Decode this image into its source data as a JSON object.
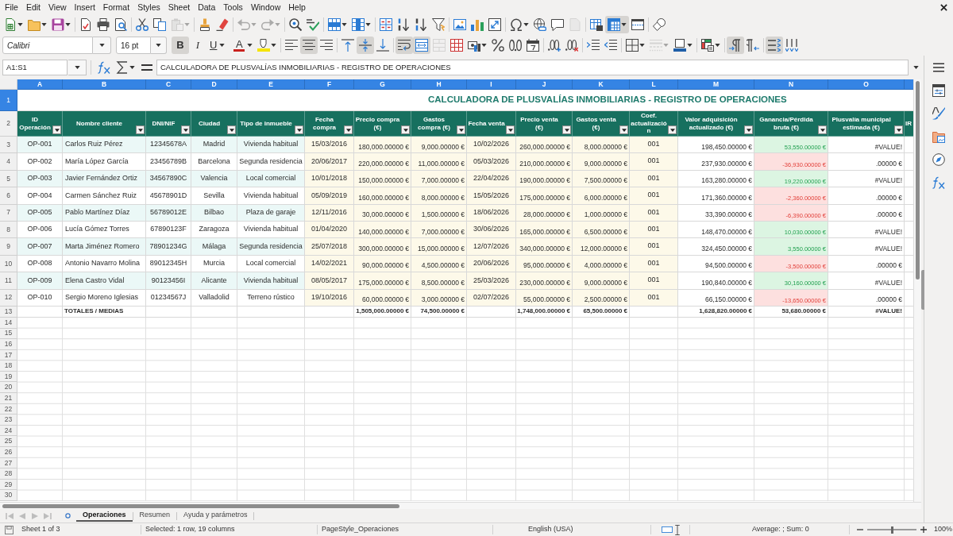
{
  "menu_bar": [
    "File",
    "Edit",
    "View",
    "Insert",
    "Format",
    "Styles",
    "Sheet",
    "Data",
    "Tools",
    "Window",
    "Help"
  ],
  "standard_toolbar": {
    "paste_enabled": false,
    "undo_enabled": false,
    "redo_enabled": false,
    "headers_footers_enabled": false,
    "freeze_rows_columns": true
  },
  "formatting_toolbar": {
    "font_name": "Calibri",
    "font_size": "16 pt",
    "bold_button": {
      "label": "B",
      "pressed": true
    },
    "italic_button": {
      "label": "I",
      "pressed": false
    },
    "underline_button": {
      "label": "U",
      "pressed": false
    },
    "font_color_label": "A",
    "align_left": false,
    "align_center": true,
    "align_right": false,
    "align_top": false,
    "align_middle": true,
    "align_bottom": false,
    "wrap_text": true,
    "merge_and_center": true,
    "merge_cells_enabled": false,
    "border_style_enabled": false,
    "left_to_right": true,
    "right_to_left": false,
    "text_horizontal": true,
    "text_vertical": false
  },
  "formula_bar": {
    "name_box": "A1:S1",
    "content": "CALCULADORA DE PLUSVALÍAS INMOBILIARIAS - REGISTRO DE OPERACIONES"
  },
  "sheet": {
    "columns": [
      {
        "letter": "A",
        "selected": true,
        "heading": "ID Operación"
      },
      {
        "letter": "B",
        "selected": true,
        "heading": "Nombre cliente"
      },
      {
        "letter": "C",
        "selected": true,
        "heading": "DNI/NIF"
      },
      {
        "letter": "D",
        "selected": true,
        "heading": "Ciudad"
      },
      {
        "letter": "E",
        "selected": true,
        "heading": "Tipo de inmueble"
      },
      {
        "letter": "F",
        "selected": true,
        "heading": "Fecha compra"
      },
      {
        "letter": "G",
        "selected": true,
        "heading": "Precio compra (€)"
      },
      {
        "letter": "H",
        "selected": true,
        "heading": "Gastos compra (€)"
      },
      {
        "letter": "I",
        "selected": true,
        "heading": "Fecha venta"
      },
      {
        "letter": "J",
        "selected": true,
        "heading": "Precio venta (€)"
      },
      {
        "letter": "K",
        "selected": true,
        "heading": "Gastos venta (€)"
      },
      {
        "letter": "L",
        "selected": true,
        "heading": "Coef. actualización"
      },
      {
        "letter": "M",
        "selected": true,
        "heading": "Valor adquisición actualizado (€)"
      },
      {
        "letter": "N",
        "selected": true,
        "heading": "Ganancia/Pérdida bruta (€)"
      },
      {
        "letter": "O",
        "selected": true,
        "heading": "Plusvalía municipal estimada (€)"
      }
    ],
    "partial_column": {
      "selected": true,
      "heading": "IR"
    },
    "autofilter": true,
    "title_row": {
      "number": "1",
      "selected": true,
      "text": "CALCULADORA DE PLUSVALÍAS INMOBILIARIAS - REGISTRO DE OPERACIONES"
    },
    "heading_row": {
      "number": "2",
      "selected": false
    },
    "rows": [
      {
        "number": "3",
        "selected": false,
        "loss": false,
        "cells": [
          "OP-001",
          "Carlos Ruiz Pérez",
          "12345678A",
          "Madrid",
          "Vivienda habitual",
          "15/03/2016",
          "180,000.00000 €",
          "9,000.00000 €",
          "10/02/2026",
          "260,000.00000 €",
          "8,000.00000 €",
          "001",
          "198,450.00000 €",
          "53,550.00000 €",
          "#VALUE!"
        ]
      },
      {
        "number": "4",
        "selected": false,
        "loss": true,
        "cells": [
          "OP-002",
          "María López García",
          "23456789B",
          "Barcelona",
          "Segunda residencia",
          "20/06/2017",
          "220,000.00000 €",
          "11,000.00000 €",
          "05/03/2026",
          "210,000.00000 €",
          "9,000.00000 €",
          "001",
          "237,930.00000 €",
          "-36,930.00000 €",
          ".00000 €"
        ]
      },
      {
        "number": "5",
        "selected": false,
        "loss": false,
        "cells": [
          "OP-003",
          "Javier Fernández Ortiz",
          "34567890C",
          "Valencia",
          "Local comercial",
          "10/01/2018",
          "150,000.00000 €",
          "7,000.00000 €",
          "22/04/2026",
          "190,000.00000 €",
          "7,500.00000 €",
          "001",
          "163,280.00000 €",
          "19,220.00000 €",
          "#VALUE!"
        ]
      },
      {
        "number": "6",
        "selected": false,
        "loss": true,
        "cells": [
          "OP-004",
          "Carmen Sánchez Ruiz",
          "45678901D",
          "Sevilla",
          "Vivienda habitual",
          "05/09/2019",
          "160,000.00000 €",
          "8,000.00000 €",
          "15/05/2026",
          "175,000.00000 €",
          "6,000.00000 €",
          "001",
          "171,360.00000 €",
          "-2,360.00000 €",
          ".00000 €"
        ]
      },
      {
        "number": "7",
        "selected": false,
        "loss": true,
        "cells": [
          "OP-005",
          "Pablo Martínez Díaz",
          "56789012E",
          "Bilbao",
          "Plaza de garaje",
          "12/11/2016",
          "30,000.00000 €",
          "1,500.00000 €",
          "18/06/2026",
          "28,000.00000 €",
          "1,000.00000 €",
          "001",
          "33,390.00000 €",
          "-6,390.00000 €",
          ".00000 €"
        ]
      },
      {
        "number": "8",
        "selected": false,
        "loss": false,
        "cells": [
          "OP-006",
          "Lucía Gómez Torres",
          "67890123F",
          "Zaragoza",
          "Vivienda habitual",
          "01/04/2020",
          "140,000.00000 €",
          "7,000.00000 €",
          "30/06/2026",
          "165,000.00000 €",
          "6,500.00000 €",
          "001",
          "148,470.00000 €",
          "10,030.00000 €",
          "#VALUE!"
        ]
      },
      {
        "number": "9",
        "selected": false,
        "loss": false,
        "cells": [
          "OP-007",
          "Marta Jiménez Romero",
          "78901234G",
          "Málaga",
          "Segunda residencia",
          "25/07/2018",
          "300,000.00000 €",
          "15,000.00000 €",
          "12/07/2026",
          "340,000.00000 €",
          "12,000.00000 €",
          "001",
          "324,450.00000 €",
          "3,550.00000 €",
          "#VALUE!"
        ]
      },
      {
        "number": "10",
        "selected": false,
        "loss": true,
        "cells": [
          "OP-008",
          "Antonio Navarro Molina",
          "89012345H",
          "Murcia",
          "Local comercial",
          "14/02/2021",
          "90,000.00000 €",
          "4,500.00000 €",
          "20/06/2026",
          "95,000.00000 €",
          "4,000.00000 €",
          "001",
          "94,500.00000 €",
          "-3,500.00000 €",
          ".00000 €"
        ]
      },
      {
        "number": "11",
        "selected": false,
        "loss": false,
        "cells": [
          "OP-009",
          "Elena Castro Vidal",
          "90123456I",
          "Alicante",
          "Vivienda habitual",
          "08/05/2017",
          "175,000.00000 €",
          "8,500.00000 €",
          "25/03/2026",
          "230,000.00000 €",
          "9,000.00000 €",
          "001",
          "190,840.00000 €",
          "30,160.00000 €",
          "#VALUE!"
        ]
      },
      {
        "number": "12",
        "selected": false,
        "loss": true,
        "cells": [
          "OP-010",
          "Sergio Moreno Iglesias",
          "01234567J",
          "Valladolid",
          "Terreno rústico",
          "19/10/2016",
          "60,000.00000 €",
          "3,000.00000 €",
          "02/07/2026",
          "55,000.00000 €",
          "2,500.00000 €",
          "001",
          "66,150.00000 €",
          "-13,650.00000 €",
          ".00000 €"
        ]
      }
    ],
    "totals_row": {
      "number": "13",
      "selected": false,
      "cells": {
        "B": "TOTALES / MEDIAS",
        "G": "1,505,000.00000 €",
        "H": "74,500.00000 €",
        "J": "1,748,000.00000 €",
        "K": "65,500.00000 €",
        "M": "1,628,820.00000 €",
        "N": "53,680.00000 €",
        "O": "#VALUE!"
      }
    },
    "empty_rows": [
      {
        "number": "14",
        "selected": false
      },
      {
        "number": "15",
        "selected": false
      },
      {
        "number": "16",
        "selected": false
      },
      {
        "number": "17",
        "selected": false
      },
      {
        "number": "18",
        "selected": false
      },
      {
        "number": "19",
        "selected": false
      },
      {
        "number": "20",
        "selected": false
      },
      {
        "number": "21",
        "selected": false
      },
      {
        "number": "22",
        "selected": false
      },
      {
        "number": "23",
        "selected": false
      },
      {
        "number": "24",
        "selected": false
      },
      {
        "number": "25",
        "selected": false
      },
      {
        "number": "26",
        "selected": false
      },
      {
        "number": "27",
        "selected": false
      },
      {
        "number": "28",
        "selected": false
      },
      {
        "number": "29",
        "selected": false
      },
      {
        "number": "30",
        "selected": false
      }
    ]
  },
  "sheet_tabs": [
    {
      "label": "Operaciones",
      "selected": true
    },
    {
      "label": "Resumen",
      "selected": false
    },
    {
      "label": "Ayuda y parámetros",
      "selected": false
    }
  ],
  "status_bar": {
    "sheet_position": "Sheet 1 of 3",
    "selection": "Selected: 1 row, 19 columns",
    "page_style": "PageStyle_Operaciones",
    "language": "English (USA)",
    "statistics": "Average: ; Sum: 0",
    "zoom": {
      "level": 0.5,
      "reading": "100%"
    }
  }
}
